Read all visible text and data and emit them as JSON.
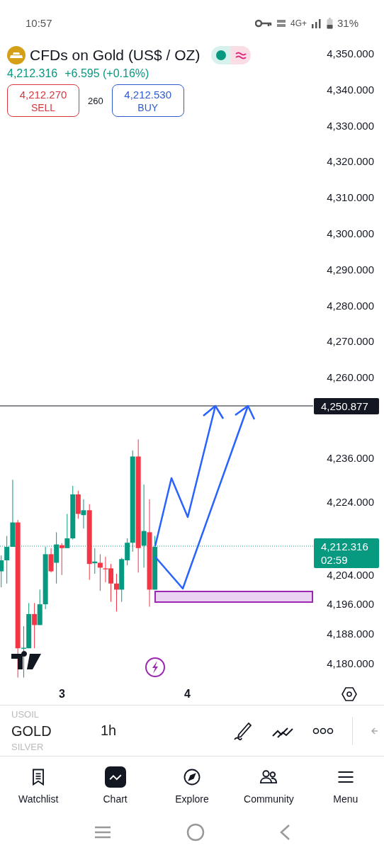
{
  "status_bar": {
    "time": "10:57",
    "network": "4G+",
    "battery": "31%"
  },
  "instrument": {
    "name": "CFDs on Gold (US$ / OZ)",
    "last_price": "4,212.316",
    "change": "+6.595 (+0.16%)"
  },
  "quote": {
    "sell_price": "4,212.270",
    "sell_label": "SELL",
    "spread": "260",
    "buy_price": "4,212.530",
    "buy_label": "BUY"
  },
  "price_axis": {
    "upper_labels": [
      "4,350.000",
      "4,340.000",
      "4,330.000",
      "4,320.000",
      "4,310.000",
      "4,300.000",
      "4,290.000",
      "4,280.000",
      "4,270.000",
      "4,260.000"
    ],
    "lower_labels": [
      "4,236.000",
      "4,224.000",
      "4,204.000",
      "4,196.000",
      "4,188.000",
      "4,180.000"
    ],
    "alert_price": "4,250.877",
    "current_price": "4,212.316",
    "countdown": "02:59"
  },
  "time_axis": [
    "3",
    "4"
  ],
  "toolbar": {
    "symbols": [
      {
        "label": "USOIL",
        "selected": false
      },
      {
        "label": "GOLD",
        "selected": true
      },
      {
        "label": "SILVER",
        "selected": false
      }
    ],
    "interval": "1h"
  },
  "bottom_nav": [
    {
      "label": "Watchlist",
      "selected": false
    },
    {
      "label": "Chart",
      "selected": true
    },
    {
      "label": "Explore",
      "selected": false
    },
    {
      "label": "Community",
      "selected": false
    },
    {
      "label": "Menu",
      "selected": false
    }
  ]
}
